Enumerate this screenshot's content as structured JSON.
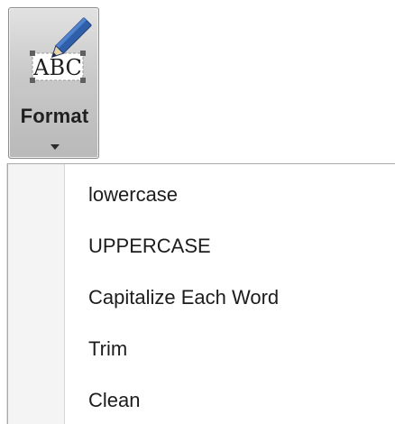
{
  "format_button": {
    "label": "Format",
    "icon_text": "ABC",
    "icon": "format-pencil-icon",
    "arrow_icon": "dropdown-arrow-icon"
  },
  "menu": {
    "items": [
      {
        "label": "lowercase"
      },
      {
        "label": "UPPERCASE"
      },
      {
        "label": "Capitalize Each Word"
      },
      {
        "label": "Trim"
      },
      {
        "label": "Clean"
      }
    ]
  },
  "colors": {
    "button_gradient_top": "#e2e2e2",
    "button_gradient_bottom": "#b9b9b9",
    "pencil_blue": "#2f5fa8",
    "menu_gutter": "#f4f4f4",
    "text": "#1c1c1c"
  }
}
